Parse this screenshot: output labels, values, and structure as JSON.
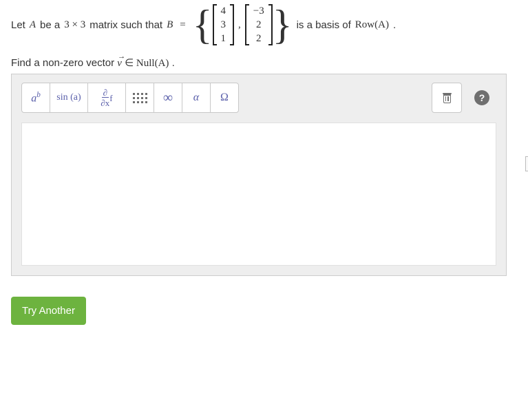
{
  "problem": {
    "pre": "Let ",
    "A": "A",
    "mid1": " be a ",
    "size": "3 × 3",
    "mid2": " matrix such that ",
    "B": "B",
    "eq": "=",
    "comma": ",",
    "vec1": [
      "4",
      "3",
      "1"
    ],
    "vec2": [
      "−3",
      "2",
      "2"
    ],
    "post1": " is a basis of ",
    "rowA": "Row(A)",
    "period": "."
  },
  "task": {
    "pre": "Find a non-zero vector ",
    "v": "v",
    "in": " ∈ ",
    "null": "Null(A)",
    "period": "."
  },
  "toolbar": {
    "ab": {
      "base": "a",
      "sup": "b"
    },
    "sin": "sin (a)",
    "deriv_num": "∂",
    "deriv_den": "∂x",
    "deriv_f": "f",
    "inf": "∞",
    "alpha": "α",
    "omega": "Ω",
    "help": "?"
  },
  "actions": {
    "try_another": "Try Another"
  }
}
